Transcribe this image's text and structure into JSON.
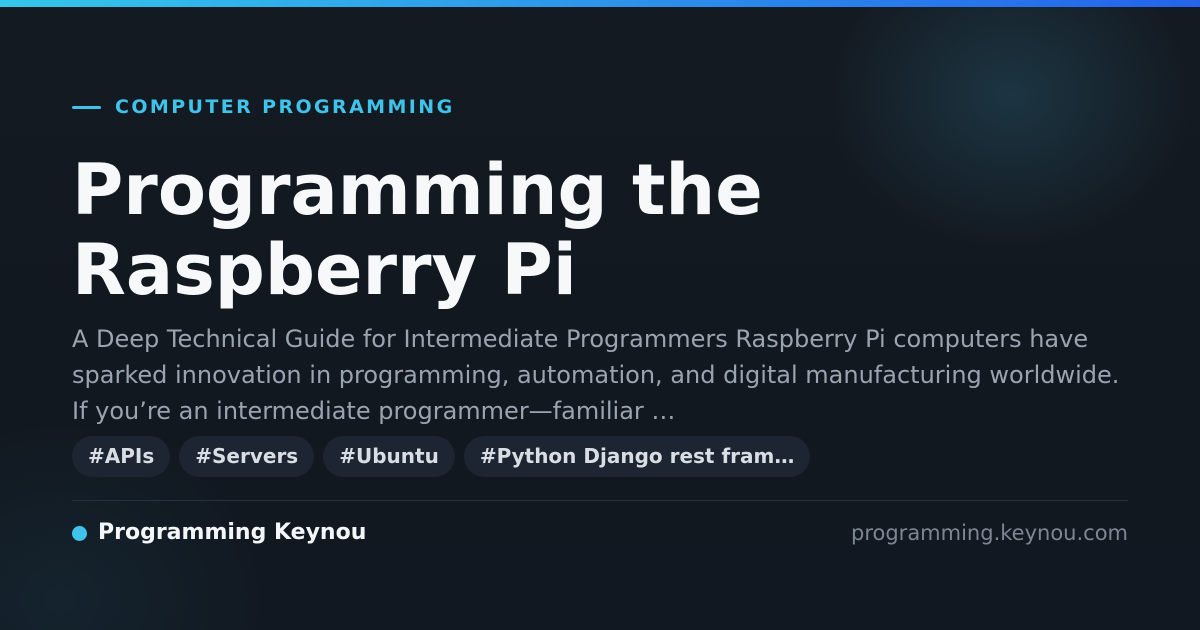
{
  "colors": {
    "accent": "#3fc3ea",
    "bar_start": "#35c6ea",
    "bar_end": "#2563eb",
    "background": "#111821"
  },
  "category": "COMPUTER PROGRAMMING",
  "title_lines": [
    "Programming the",
    "Raspberry Pi"
  ],
  "description": "A Deep Technical Guide for Intermediate Programmers Raspberry Pi computers have sparked innovation in programming, automation, and digital manufacturing worldwide. If you’re an intermediate programmer—familiar …",
  "tags": [
    "#APIs",
    "#Servers",
    "#Ubuntu",
    "#Python Django rest fram…"
  ],
  "footer": {
    "brand_name": "Programming Keynou",
    "site_url": "programming.keynou.com"
  }
}
